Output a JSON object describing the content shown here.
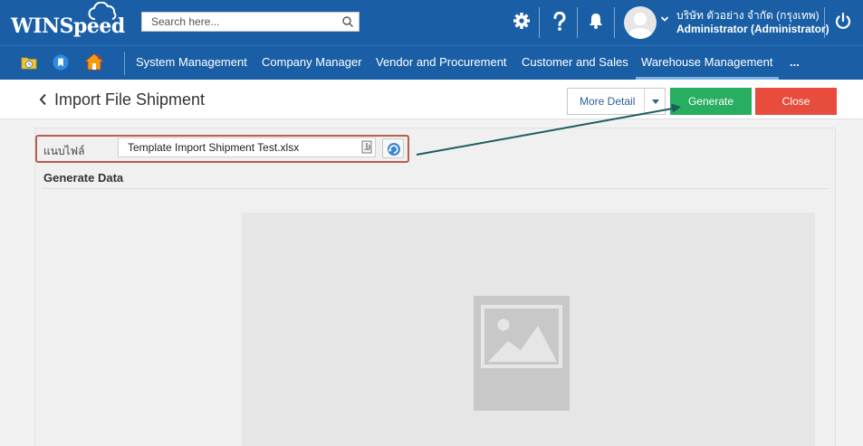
{
  "app": {
    "logo_text": "WINSpeed",
    "search_placeholder": "Search here..."
  },
  "user": {
    "company": "บริษัท ตัวอย่าง จำกัด (กรุงเทพ)",
    "role": "Administrator (Administrator)"
  },
  "topbar_icons": [
    "gear-icon",
    "help-icon",
    "bell-icon",
    "power-icon"
  ],
  "nav": {
    "items": [
      {
        "label": "System Management"
      },
      {
        "label": "Company Manager"
      },
      {
        "label": "Vendor and Procurement"
      },
      {
        "label": "Customer and Sales"
      },
      {
        "label": "Warehouse Management",
        "active": true
      },
      {
        "label": "..."
      }
    ]
  },
  "page": {
    "title": "Import File Shipment",
    "more_detail_label": "More Detail",
    "generate_label": "Generate",
    "close_label": "Close"
  },
  "form": {
    "attach_label": "แนบไฟล์",
    "file_value": "Template Import Shipment Test.xlsx",
    "section_title": "Generate Data"
  },
  "colors": {
    "primary": "#1a5fa6",
    "generate": "#27ae60",
    "close": "#e74c3c",
    "highlight": "#b95c4c",
    "arrow": "#1f5c5c"
  }
}
